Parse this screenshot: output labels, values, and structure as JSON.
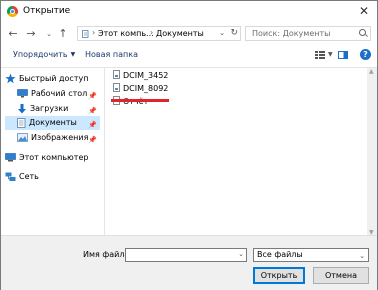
{
  "window": {
    "title": "Открытие"
  },
  "address": {
    "segments": [
      "Этот компь...",
      "Документы"
    ]
  },
  "search": {
    "placeholder": "Поиск: Документы"
  },
  "toolbar": {
    "organize": "Упорядочить",
    "new_folder": "Новая папка"
  },
  "sidebar": {
    "items": [
      {
        "label": "Быстрый доступ",
        "icon": "star-icon"
      },
      {
        "label": "Рабочий стол",
        "icon": "desktop-icon",
        "pinned": true
      },
      {
        "label": "Загрузки",
        "icon": "download-icon",
        "pinned": true
      },
      {
        "label": "Документы",
        "icon": "documents-icon",
        "pinned": true,
        "selected": true
      },
      {
        "label": "Изображения",
        "icon": "pictures-icon",
        "pinned": true
      },
      {
        "label": "Этот компьютер",
        "icon": "computer-icon"
      },
      {
        "label": "Сеть",
        "icon": "network-icon"
      }
    ]
  },
  "files": [
    {
      "name": "DCIM_3452",
      "icon": "image-file-icon"
    },
    {
      "name": "DCIM_8092",
      "icon": "image-file-icon"
    },
    {
      "name": "Отчёт",
      "icon": "text-file-icon"
    }
  ],
  "bottom": {
    "filename_label": "Имя файла:",
    "filename_value": "",
    "filter": "Все файлы",
    "open": "Открыть",
    "cancel": "Отмена"
  },
  "colors": {
    "selected_bg": "#cce8ff",
    "highlight_red": "#e2232a",
    "accent_blue": "#0078d7"
  }
}
